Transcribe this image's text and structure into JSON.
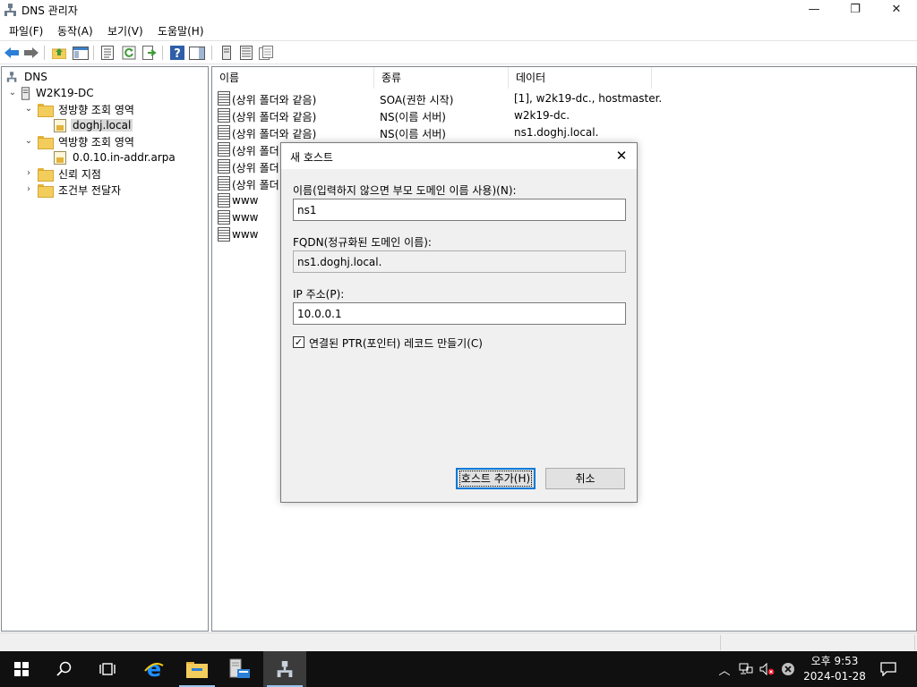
{
  "window": {
    "title": "DNS 관리자",
    "controls": {
      "minimize": "—",
      "maximize": "❐",
      "close": "✕"
    }
  },
  "menu": [
    "파일(F)",
    "동작(A)",
    "보기(V)",
    "도움말(H)"
  ],
  "tree": {
    "root": "DNS",
    "server": "W2K19-DC",
    "forward_zones": "정방향 조회 영역",
    "forward_zone_item": "doghj.local",
    "reverse_zones": "역방향 조회 영역",
    "reverse_zone_item": "0.0.10.in-addr.arpa",
    "trust_points": "신뢰 지점",
    "conditional_forwarders": "조건부 전달자"
  },
  "list": {
    "columns": [
      "이름",
      "종류",
      "데이터"
    ],
    "rows": [
      {
        "name": "(상위 폴더와 같음)",
        "type": "SOA(권한 시작)",
        "data": "[1], w2k19-dc., hostmaster."
      },
      {
        "name": "(상위 폴더와 같음)",
        "type": "NS(이름 서버)",
        "data": "w2k19-dc."
      },
      {
        "name": "(상위 폴더와 같음)",
        "type": "NS(이름 서버)",
        "data": "ns1.doghj.local."
      },
      {
        "name": "(상위 폴더",
        "type": "",
        "data": ""
      },
      {
        "name": "(상위 폴더",
        "type": "",
        "data": ""
      },
      {
        "name": "(상위 폴더",
        "type": "",
        "data": ""
      },
      {
        "name": "www",
        "type": "",
        "data": ""
      },
      {
        "name": "www",
        "type": "",
        "data": ""
      },
      {
        "name": "www",
        "type": "",
        "data": ""
      }
    ]
  },
  "dialog": {
    "title": "새 호스트",
    "close": "✕",
    "name_label": "이름(입력하지 않으면 부모 도메인 이름 사용)(N):",
    "name_value": "ns1",
    "fqdn_label": "FQDN(정규화된 도메인 이름):",
    "fqdn_value": "ns1.doghj.local.",
    "ip_label": "IP 주소(P):",
    "ip_value": "10.0.0.1",
    "ptr_label": "연결된 PTR(포인터) 레코드 만들기(C)",
    "ptr_checked": "✓",
    "add_button": "호스트 추가(H)",
    "cancel_button": "취소"
  },
  "taskbar": {
    "clock_time": "오후 9:53",
    "clock_date": "2024-01-28",
    "tray_chevron": "︿",
    "accent": "#9ac4ec"
  }
}
